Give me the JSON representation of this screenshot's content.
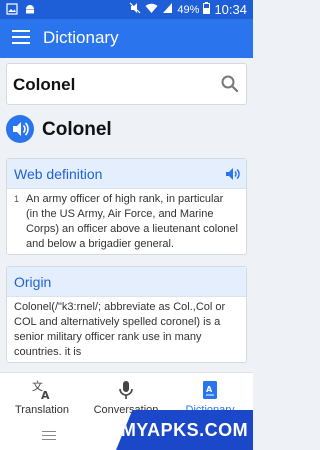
{
  "status_bar": {
    "left_icons": [
      "image-icon",
      "android-icon"
    ],
    "right_icons": [
      "mute-icon",
      "wifi-icon",
      "signal-icon",
      "battery-icon"
    ],
    "battery": "49%",
    "time": "10:34"
  },
  "app_bar": {
    "title": "Dictionary"
  },
  "search": {
    "value": "Colonel",
    "icon": "search-icon"
  },
  "entry": {
    "word": "Colonel",
    "speaker_icon": "speaker-icon"
  },
  "web_definition": {
    "heading": "Web definition",
    "items": [
      {
        "number": "1",
        "text": "An army officer of high rank, in particular (in the US Army, Air Force, and Marine Corps) an officer above a lieutenant colonel and below a brigadier general."
      }
    ]
  },
  "origin": {
    "heading": "Origin",
    "text": "Colonel(/\"k3:rnel/; abbreviate as Col.,Col or COL and alternatively spelled coronel) is a senior military  officer rank use in many countries. it is"
  },
  "bottom_nav": {
    "items": [
      {
        "label": "Translation",
        "icon": "translate-icon"
      },
      {
        "label": "Conversation",
        "icon": "microphone-icon"
      },
      {
        "label": "Dictionary",
        "icon": "dictionary-icon"
      }
    ]
  },
  "watermark": "MYAPKS.COM",
  "colors": {
    "primary": "#2a74ee",
    "status_bar": "#1e5fd8",
    "heading": "#1e63d6",
    "card_header": "#e5eefc"
  }
}
